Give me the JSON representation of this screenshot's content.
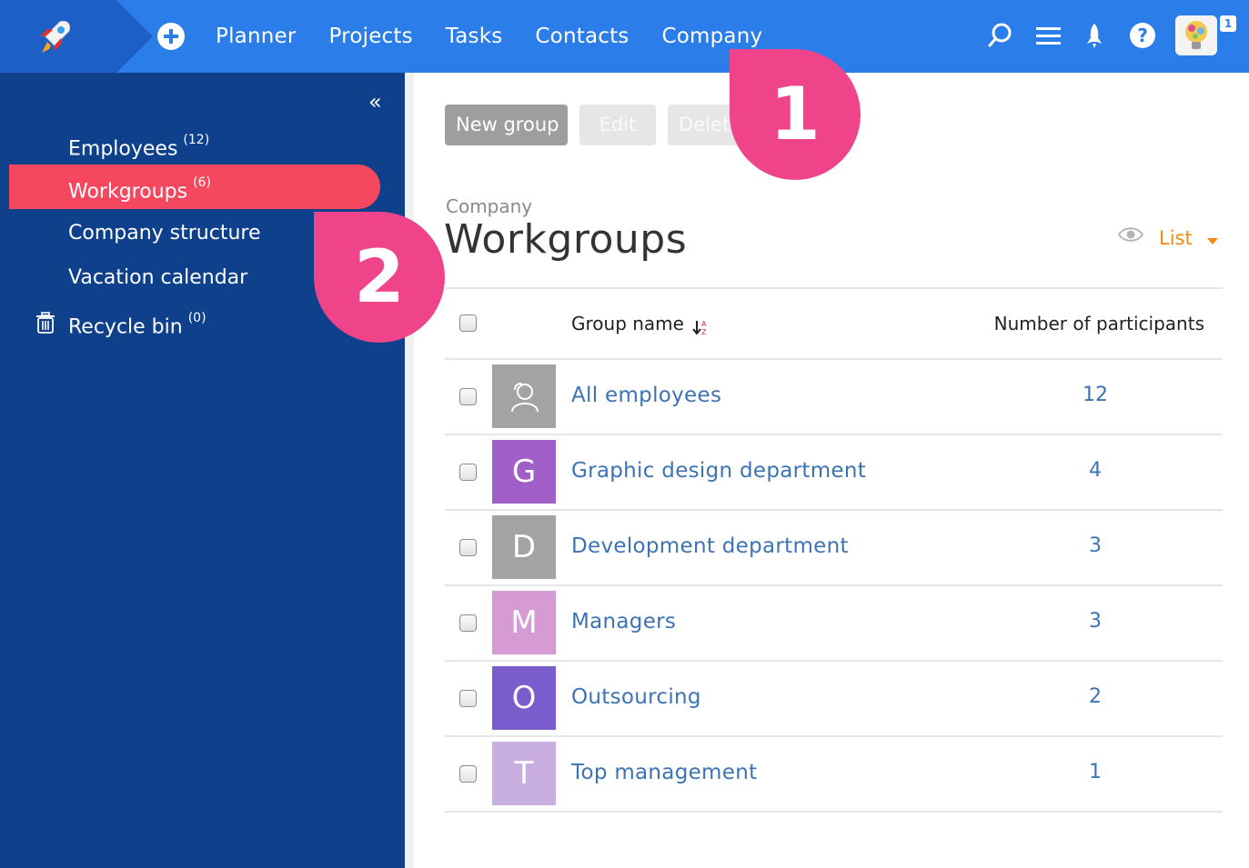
{
  "topbar": {
    "nav": [
      "Planner",
      "Projects",
      "Tasks",
      "Contacts",
      "Company"
    ],
    "notification_count": "1",
    "colors": {
      "bar": "#2b7de9",
      "logo_zone": "#1d5fc4"
    }
  },
  "sidebar": {
    "collapse_label": "«",
    "items": [
      {
        "label": "Employees",
        "count": "(12)",
        "active": false
      },
      {
        "label": "Workgroups",
        "count": "(6)",
        "active": true
      },
      {
        "label": "Company structure",
        "count": "",
        "active": false
      },
      {
        "label": "Vacation calendar",
        "count": "",
        "active": false
      },
      {
        "label": "Recycle bin",
        "count": "(0)",
        "active": false,
        "icon": "trash-icon"
      }
    ]
  },
  "toolbar": {
    "new_group": "New group",
    "edit": "Edit",
    "delete": "Delete"
  },
  "page": {
    "breadcrumb": "Company",
    "title": "Workgroups",
    "view_mode": "List"
  },
  "table": {
    "headers": {
      "name": "Group name",
      "count": "Number of participants"
    },
    "rows": [
      {
        "icon": "users-icon",
        "letter": "",
        "color": "#a3a3a3",
        "name": "All employees",
        "count": "12"
      },
      {
        "icon": "",
        "letter": "G",
        "color": "#a05ec7",
        "name": "Graphic design department",
        "count": "4"
      },
      {
        "icon": "",
        "letter": "D",
        "color": "#a3a3a3",
        "name": "Development department",
        "count": "3"
      },
      {
        "icon": "",
        "letter": "M",
        "color": "#d69ad4",
        "name": "Managers",
        "count": "3"
      },
      {
        "icon": "",
        "letter": "O",
        "color": "#7a5ccc",
        "name": "Outsourcing",
        "count": "2"
      },
      {
        "icon": "",
        "letter": "T",
        "color": "#c9aee2",
        "name": "Top management",
        "count": "1"
      }
    ]
  },
  "callouts": {
    "first": "1",
    "second": "2"
  }
}
